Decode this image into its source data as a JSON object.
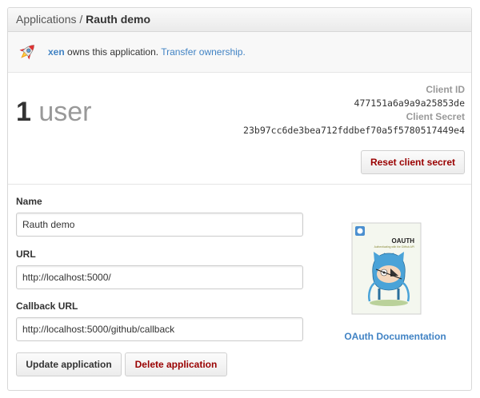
{
  "breadcrumb": {
    "parent": "Applications",
    "separator": " / ",
    "current": "Rauth demo"
  },
  "owner": {
    "name": "xen",
    "text": " owns this application. ",
    "transfer_link": "Transfer ownership."
  },
  "stats": {
    "user_count": "1",
    "user_label": " user"
  },
  "client": {
    "id_label": "Client ID",
    "id_value": "477151a6a9a9a25853de",
    "secret_label": "Client Secret",
    "secret_value": "23b97cc6de3bea712fddbef70a5f5780517449e4",
    "reset_button": "Reset client secret"
  },
  "form": {
    "name_label": "Name",
    "name_value": "Rauth demo",
    "url_label": "URL",
    "url_value": "http://localhost:5000/",
    "callback_label": "Callback URL",
    "callback_value": "http://localhost:5000/github/callback",
    "update_button": "Update application",
    "delete_button": "Delete application"
  },
  "docs": {
    "link": "OAuth Documentation",
    "cover_title": "OAUTH",
    "cover_subtitle": "Authenticating with the GitHub API"
  },
  "colors": {
    "link": "#4183c4",
    "danger": "#990000"
  },
  "icons": [
    "rocket-icon",
    "octocat-book-cover"
  ]
}
